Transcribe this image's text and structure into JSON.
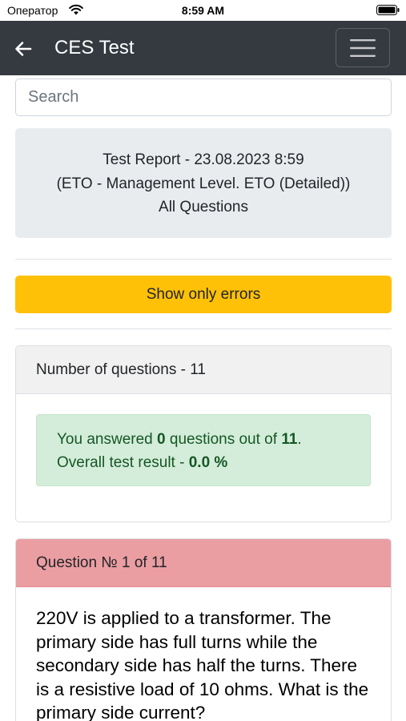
{
  "status_bar": {
    "carrier": "Оператор",
    "time": "8:59 AM",
    "wifi_icon": "wifi-icon",
    "battery_icon": "battery-icon"
  },
  "navbar": {
    "back_icon": "arrow-left-icon",
    "title": "CES Test",
    "menu_icon": "hamburger-menu-icon"
  },
  "search": {
    "placeholder": "Search",
    "value": ""
  },
  "report": {
    "line1": "Test Report - 23.08.2023 8:59",
    "line2": "(ETO - Management Level. ETO (Detailed))",
    "line3": "All Questions"
  },
  "errors_button": {
    "label": "Show only errors",
    "color": "#ffc107"
  },
  "summary_card": {
    "header": "Number of questions - 11",
    "answered_prefix": "You answered ",
    "answered_count": "0",
    "answered_middle": " questions out of ",
    "total_count": "11",
    "answered_suffix": ".",
    "result_prefix": "Overall test result - ",
    "result_value": "0.0 %"
  },
  "question_card": {
    "header": "Question № 1 of 11",
    "text": "220V is applied to a transformer. The primary side has full turns while the secondary side has half the turns. There is a resistive load of 10 ohms. What is the primary side current?"
  },
  "colors": {
    "navbar": "#343a40",
    "alert_success_bg": "#d4edda",
    "alert_success_text": "#155724",
    "danger_header": "#eb9ea2"
  }
}
